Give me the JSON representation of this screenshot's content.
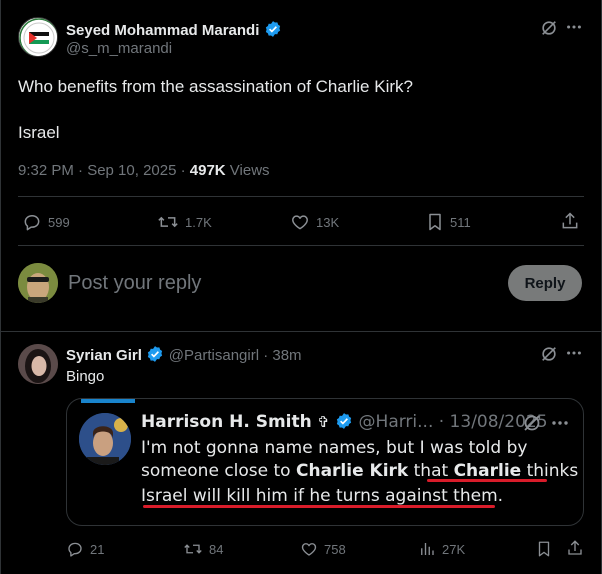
{
  "main_post": {
    "author_name": "Seyed Mohammad Marandi",
    "handle": "@s_m_marandi",
    "text_line1": "Who benefits from the assassination of Charlie Kirk?",
    "text_line2": "Israel",
    "timestamp": "9:32 PM · Sep 10, 2025 · ",
    "views_count": "497K",
    "views_label": " Views",
    "actions": {
      "replies": "599",
      "reposts": "1.7K",
      "likes": "13K",
      "bookmarks": "511"
    }
  },
  "reply_composer": {
    "placeholder": "Post your reply",
    "button_label": "Reply"
  },
  "reply_post": {
    "author_name": "Syrian Girl",
    "handle_time": "@Partisangirl · 38m",
    "text": "Bingo",
    "actions": {
      "replies": "21",
      "reposts": "84",
      "likes": "758",
      "views": "27K"
    }
  },
  "quoted_post": {
    "author_name": "Harrison H. Smith",
    "cross": "✞",
    "handle_date": "@Harri... · 13/08/2025",
    "line1": "I'm not gonna name names, but I was told by",
    "line2_a": "someone close to ",
    "line2_b": "Charlie Kirk",
    "line2_c": " that ",
    "line2_d": "Charlie",
    "line2_e": " thinks",
    "line3": "Israel will kill him if he turns against them."
  },
  "colors": {
    "background": "#000000",
    "verified": "#1d9bf0",
    "underline": "#d91c2a",
    "muted": "#71767b"
  }
}
